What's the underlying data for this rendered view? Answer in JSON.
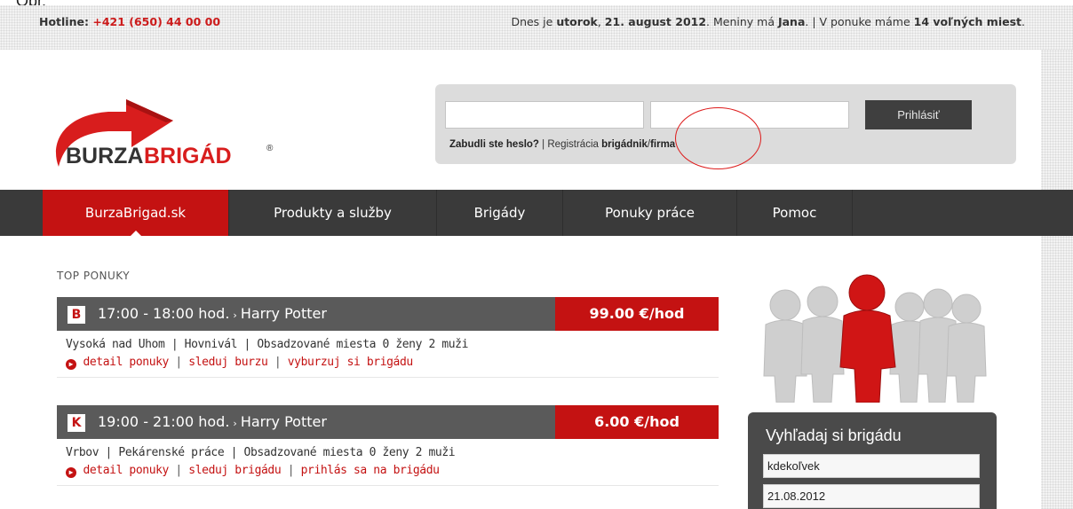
{
  "topbar": {
    "hotline_label": "Hotline:",
    "hotline_number": "+421 (650) 44 00 00",
    "date_prefix": "Dnes je",
    "day": "utorok",
    "date": "21. august 2012",
    "nameday_prefix": ". Meniny má",
    "nameday": "Jana",
    "offer_prefix": ". | V ponuke máme",
    "free_places": "14 voľných miest",
    "suffix": "."
  },
  "header": {
    "logo_text_a": "BURZA",
    "logo_text_b": "BRIGÁD",
    "logo_reg": "®",
    "login_button": "Prihlásiť",
    "forgot_password": "Zabudli ste heslo?",
    "separator": "|",
    "registration": "Registrácia",
    "reg_worker": "brigádnik",
    "slash": "/",
    "reg_company": "firma"
  },
  "nav": {
    "items": [
      {
        "label": "BurzaBrigad.sk"
      },
      {
        "label": "Produkty a služby"
      },
      {
        "label": "Brigády"
      },
      {
        "label": "Ponuky práce"
      },
      {
        "label": "Pomoc"
      }
    ]
  },
  "main": {
    "section_title": "TOP PONUKY",
    "offers": [
      {
        "badge": "B",
        "time": "17:00 - 18:00 hod.",
        "arrow": "›",
        "title": "Harry Potter",
        "price": "99.00 €/hod",
        "info": "Vysoká nad Uhom | Hovnivál | Obsadzované miesta 0 ženy 2 muži",
        "link1": "detail ponuky",
        "link2": "sleduj burzu",
        "link3": "vyburzuj si brigádu"
      },
      {
        "badge": "K",
        "time": "19:00 - 21:00 hod.",
        "arrow": "›",
        "title": "Harry Potter",
        "price": "6.00 €/hod",
        "info": "Vrbov | Pekárenské práce | Obsadzované miesta 0 ženy 2 muži",
        "link1": "detail ponuky",
        "link2": "sleduj brigádu",
        "link3": "prihlás sa na brigádu"
      }
    ]
  },
  "sidebar": {
    "search_title": "Vyhľadaj si brigádu",
    "location_value": "kdekoľvek",
    "date_value": "21.08.2012"
  },
  "colors": {
    "accent": "#c41212",
    "nav_bg": "#3a3a3a",
    "offer_head": "#5a5a5a"
  }
}
